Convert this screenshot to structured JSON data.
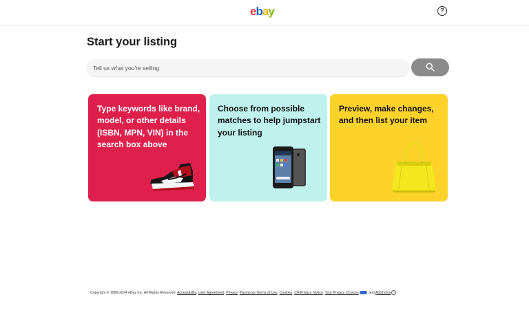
{
  "header": {
    "logo": {
      "e": "e",
      "b": "b",
      "a": "a",
      "y": "y",
      "colors": {
        "e": "#e53238",
        "b": "#0064d2",
        "a": "#f5af02",
        "y": "#86b817"
      }
    },
    "help_icon": "?"
  },
  "page_title": "Start your listing",
  "search": {
    "placeholder": "Tell us what you're selling",
    "button_icon": "search-icon"
  },
  "cards": [
    {
      "text": "Type keywords like brand, model, or other details (ISBN, MPN, VIN) in the search box above",
      "bg": "#e0204c",
      "image": "sneaker-image"
    },
    {
      "text": "Choose from possible matches to help jumpstart your listing",
      "bg": "#bff2ed",
      "image": "phone-image"
    },
    {
      "text": "Preview, make changes, and then list your item",
      "bg": "#fdd22b",
      "image": "handbag-image"
    }
  ],
  "footer": {
    "copyright": "Copyright © 1995-2024 eBay Inc. All Rights Reserved.",
    "links": [
      "Accessibility",
      "User Agreement",
      "Privacy",
      "Payments Terms of Use",
      "Cookies",
      "CA Privacy Notice",
      "Your Privacy Choices"
    ],
    "and_text": "and",
    "adchoice": "AdChoice"
  }
}
